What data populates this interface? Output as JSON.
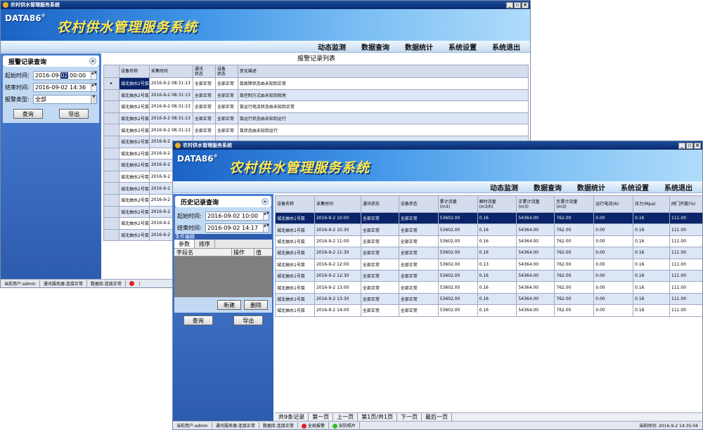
{
  "app": {
    "window_title": "农村供水管理服务系统",
    "logo": "DATA86",
    "logo_mark": "®",
    "banner_title": "农村供水管理服务系统"
  },
  "menu": [
    "动态监测",
    "数据查询",
    "数据统计",
    "系统设置",
    "系统退出"
  ],
  "w1": {
    "panel_title": "报警记录查询",
    "start_label": "起始时间:",
    "start_pre": "2016-09-",
    "start_hl": "02",
    "start_post": " 00:00",
    "end_label": "结束时间:",
    "end_value": "2016-09-02 14:36",
    "type_label": "报警类型:",
    "type_value": "全部",
    "query_button": "查询",
    "export_button": "导出",
    "table_title": "报警记录列表",
    "columns": [
      "设备名称",
      "采集时间",
      "通讯\n状态",
      "设备\n状态",
      "变化描述"
    ],
    "rows": [
      [
        "城北抽水2号泵",
        "2016-9-2 08:31:13",
        "全部正常",
        "全部正常",
        "泵故障状态由未知到正常"
      ],
      [
        "城北抽水2号泵",
        "2016-9-2 08:31:13",
        "全部正常",
        "全部正常",
        "泵控制方式由未知到就地"
      ],
      [
        "城北抽水2号泵",
        "2016-9-2 08:31:13",
        "全部正常",
        "全部正常",
        "泵运行电流状态由未知到正常"
      ],
      [
        "城北抽水2号泵",
        "2016-9-2 08:31:13",
        "全部正常",
        "全部正常",
        "泵运行状态由未知到运行"
      ],
      [
        "城北抽水2号泵",
        "2016-9-2 08:31:13",
        "全部正常",
        "全部正常",
        "泵状态由未知到运行"
      ],
      [
        "城北抽水2号泵",
        "2016-9-2",
        "",
        "",
        ""
      ],
      [
        "城北抽水2号泵",
        "2016-9-2",
        "",
        "",
        ""
      ],
      [
        "城北抽水2号泵",
        "2016-9-2",
        "",
        "",
        ""
      ],
      [
        "城北抽水2号泵",
        "2016-9-2",
        "",
        "",
        ""
      ],
      [
        "城北抽水2号泵",
        "2016-9-2",
        "",
        "",
        ""
      ],
      [
        "城北抽水2号泵",
        "2016-9-2",
        "",
        "",
        ""
      ],
      [
        "城北抽水2号泵",
        "2016-9-2",
        "",
        "",
        ""
      ],
      [
        "城北抽水2号泵",
        "2016-9-2",
        "",
        "",
        ""
      ],
      [
        "城北抽水2号泵",
        "2016-9-2",
        "",
        "",
        ""
      ]
    ],
    "status": {
      "user": "当前用户:admin",
      "comm": "通讯服务器:连接正常",
      "db": "数据库:连接正常"
    }
  },
  "w2": {
    "panel_title": "历史记录查询",
    "start_label": "起始时间:",
    "start_value": "2016-09-02 10:00",
    "end_label": "结束时间:",
    "end_value": "2016-09-02 14:17",
    "cond_label": "条件编辑",
    "tabs": [
      "参数",
      "排序"
    ],
    "fe_cols": [
      "字段名",
      "操作",
      "值"
    ],
    "new_button": "新建",
    "delete_button": "删除",
    "query_button": "查询",
    "export_button": "导出",
    "columns": [
      "设备名称",
      "采集时间",
      "通讯状态",
      "设备状态",
      "累计流量\n(m3)",
      "瞬时流量\n(m3/h)",
      "正累计流量\n(m3)",
      "负累计流量\n(m3)",
      "运行电流(A)",
      "压力(Mpa)",
      "阀门开度(%)"
    ],
    "rows": [
      [
        "城北抽水1号泵",
        "2016-9-2 10:00",
        "全部正常",
        "全部正常",
        "53602.00",
        "0.16",
        "54364.00",
        "762.00",
        "0.00",
        "0.16",
        "111.00"
      ],
      [
        "城北抽水1号泵",
        "2016-9-2 10:30",
        "全部正常",
        "全部正常",
        "53602.00",
        "0.16",
        "54364.00",
        "762.00",
        "0.00",
        "0.16",
        "111.00"
      ],
      [
        "城北抽水1号泵",
        "2016-9-2 11:00",
        "全部正常",
        "全部正常",
        "53602.00",
        "0.16",
        "54364.00",
        "762.00",
        "0.00",
        "0.16",
        "111.00"
      ],
      [
        "城北抽水1号泵",
        "2016-9-2 11:30",
        "全部正常",
        "全部正常",
        "53602.00",
        "0.16",
        "54364.00",
        "762.00",
        "0.00",
        "0.16",
        "111.00"
      ],
      [
        "城北抽水1号泵",
        "2016-9-2 12:00",
        "全部正常",
        "全部正常",
        "53602.00",
        "0.13",
        "54364.00",
        "762.00",
        "0.00",
        "0.16",
        "111.00"
      ],
      [
        "城北抽水1号泵",
        "2016-9-2 12:30",
        "全部正常",
        "全部正常",
        "53602.00",
        "0.16",
        "54364.00",
        "762.00",
        "0.00",
        "0.16",
        "111.00"
      ],
      [
        "城北抽水1号泵",
        "2016-9-2 13:00",
        "全部正常",
        "全部正常",
        "53602.00",
        "0.16",
        "54364.00",
        "762.00",
        "0.00",
        "0.16",
        "111.00"
      ],
      [
        "城北抽水1号泵",
        "2016-9-2 13:30",
        "全部正常",
        "全部正常",
        "53602.00",
        "0.16",
        "54364.00",
        "762.00",
        "0.00",
        "0.16",
        "111.00"
      ],
      [
        "城北抽水1号泵",
        "2016-9-2 14:00",
        "全部正常",
        "全部正常",
        "53602.00",
        "0.16",
        "54364.00",
        "762.00",
        "0.00",
        "0.16",
        "111.00"
      ]
    ],
    "pager": [
      "共9条记录",
      "第一页",
      "上一页",
      "第1页/共1页",
      "下一页",
      "最后一页"
    ],
    "status": {
      "user": "当前用户:admin",
      "comm": "通讯服务器:连接正常",
      "db": "数据库:连接正常",
      "alarm": "全局报警",
      "security": "安防照片",
      "time": "当前时间: 2016-9-2 14:35:04"
    }
  },
  "colors": {
    "alarm_dot": "#e02020",
    "security_dot": "#30c030",
    "selected_row": "#0a246a"
  }
}
